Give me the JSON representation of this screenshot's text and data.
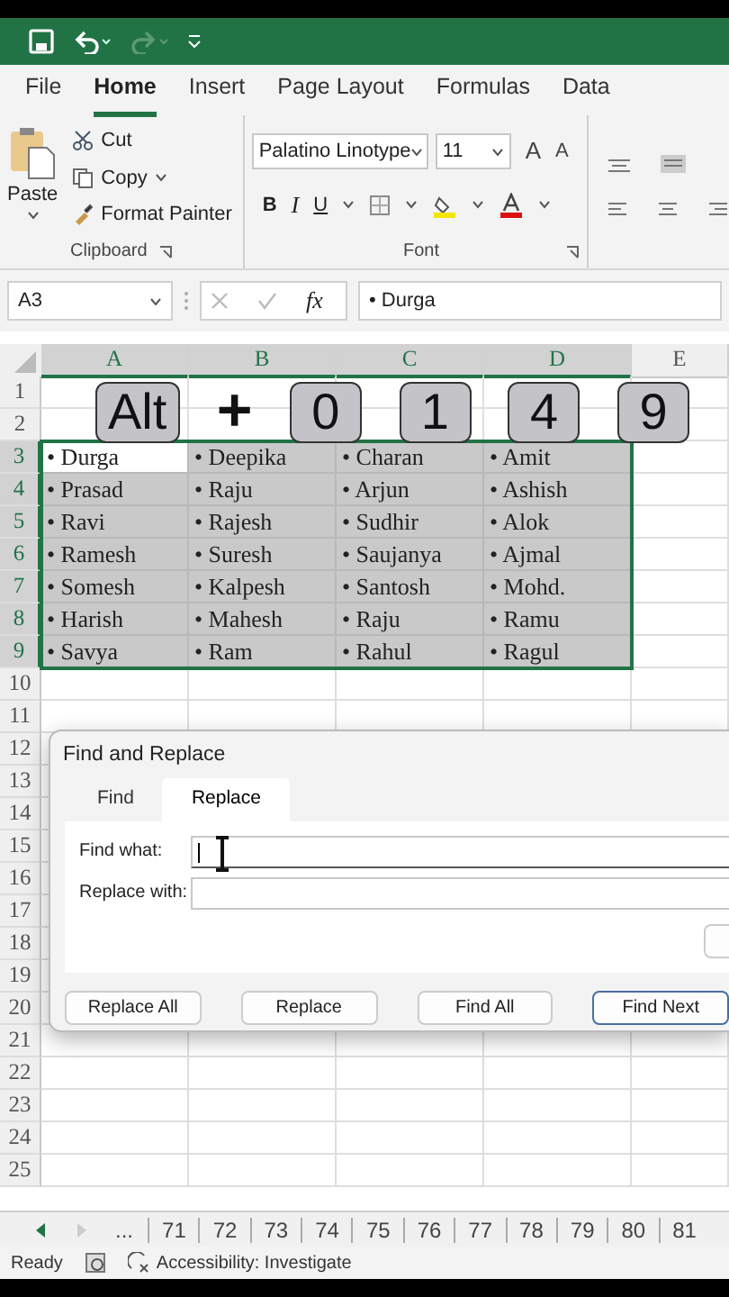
{
  "ribbon": {
    "tabs": [
      {
        "label": "File",
        "selected": false
      },
      {
        "label": "Home",
        "selected": true
      },
      {
        "label": "Insert",
        "selected": false
      },
      {
        "label": "Page Layout",
        "selected": false
      },
      {
        "label": "Formulas",
        "selected": false
      },
      {
        "label": "Data",
        "selected": false
      }
    ],
    "clipboard": {
      "paste": "Paste",
      "cut": "Cut",
      "copy": "Copy",
      "format_painter": "Format Painter",
      "label": "Clipboard"
    },
    "font": {
      "name": "Palatino Linotype",
      "size": "11",
      "grow": "A",
      "shrink": "A",
      "bold": "B",
      "italic": "I",
      "underline": "U",
      "label": "Font"
    }
  },
  "formula_bar": {
    "name_box": "A3",
    "fx": "fx",
    "formula": "• Durga"
  },
  "sheet": {
    "columns": [
      {
        "label": "A",
        "selected": true
      },
      {
        "label": "B",
        "selected": true
      },
      {
        "label": "C",
        "selected": true
      },
      {
        "label": "D",
        "selected": true
      },
      {
        "label": "E",
        "selected": false
      }
    ],
    "rows": [
      {
        "header": "1",
        "selected": false,
        "cells": []
      },
      {
        "header": "2",
        "selected": false,
        "cells": []
      },
      {
        "header": "3",
        "selected": true,
        "cells": [
          {
            "text": "• Durga",
            "selected": true,
            "active": true
          },
          {
            "text": "• Deepika",
            "selected": true,
            "active": false
          },
          {
            "text": "• Charan",
            "selected": true,
            "active": false
          },
          {
            "text": "• Amit",
            "selected": true,
            "active": false
          }
        ]
      },
      {
        "header": "4",
        "selected": true,
        "cells": [
          {
            "text": "• Prasad",
            "selected": true,
            "active": false
          },
          {
            "text": "• Raju",
            "selected": true,
            "active": false
          },
          {
            "text": "• Arjun",
            "selected": true,
            "active": false
          },
          {
            "text": "• Ashish",
            "selected": true,
            "active": false
          }
        ]
      },
      {
        "header": "5",
        "selected": true,
        "cells": [
          {
            "text": "• Ravi",
            "selected": true,
            "active": false
          },
          {
            "text": "• Rajesh",
            "selected": true,
            "active": false
          },
          {
            "text": "• Sudhir",
            "selected": true,
            "active": false
          },
          {
            "text": "• Alok",
            "selected": true,
            "active": false
          }
        ]
      },
      {
        "header": "6",
        "selected": true,
        "cells": [
          {
            "text": "• Ramesh",
            "selected": true,
            "active": false
          },
          {
            "text": "• Suresh",
            "selected": true,
            "active": false
          },
          {
            "text": "• Saujanya",
            "selected": true,
            "active": false
          },
          {
            "text": "• Ajmal",
            "selected": true,
            "active": false
          }
        ]
      },
      {
        "header": "7",
        "selected": true,
        "cells": [
          {
            "text": "• Somesh",
            "selected": true,
            "active": false
          },
          {
            "text": "• Kalpesh",
            "selected": true,
            "active": false
          },
          {
            "text": "• Santosh",
            "selected": true,
            "active": false
          },
          {
            "text": "• Mohd.",
            "selected": true,
            "active": false
          }
        ]
      },
      {
        "header": "8",
        "selected": true,
        "cells": [
          {
            "text": "• Harish",
            "selected": true,
            "active": false
          },
          {
            "text": "• Mahesh",
            "selected": true,
            "active": false
          },
          {
            "text": "• Raju",
            "selected": true,
            "active": false
          },
          {
            "text": "• Ramu",
            "selected": true,
            "active": false
          }
        ]
      },
      {
        "header": "9",
        "selected": true,
        "cells": [
          {
            "text": "• Savya",
            "selected": true,
            "active": false
          },
          {
            "text": "• Ram",
            "selected": true,
            "active": false
          },
          {
            "text": "• Rahul",
            "selected": true,
            "active": false
          },
          {
            "text": "• Ragul",
            "selected": true,
            "active": false
          }
        ]
      },
      {
        "header": "10",
        "selected": false,
        "cells": []
      },
      {
        "header": "11",
        "selected": false,
        "cells": []
      },
      {
        "header": "12",
        "selected": false,
        "cells": []
      },
      {
        "header": "13",
        "selected": false,
        "cells": []
      },
      {
        "header": "14",
        "selected": false,
        "cells": []
      },
      {
        "header": "15",
        "selected": false,
        "cells": []
      },
      {
        "header": "16",
        "selected": false,
        "cells": []
      },
      {
        "header": "17",
        "selected": false,
        "cells": []
      },
      {
        "header": "18",
        "selected": false,
        "cells": []
      },
      {
        "header": "19",
        "selected": false,
        "cells": []
      },
      {
        "header": "20",
        "selected": false,
        "cells": []
      },
      {
        "header": "21",
        "selected": false,
        "cells": []
      },
      {
        "header": "22",
        "selected": false,
        "cells": []
      },
      {
        "header": "23",
        "selected": false,
        "cells": []
      },
      {
        "header": "24",
        "selected": false,
        "cells": []
      },
      {
        "header": "25",
        "selected": false,
        "cells": []
      }
    ]
  },
  "keys": [
    {
      "label": "Alt",
      "kind": "key"
    },
    {
      "label": "+",
      "kind": "plus"
    },
    {
      "label": "0",
      "kind": "key"
    },
    {
      "label": "1",
      "kind": "key"
    },
    {
      "label": "4",
      "kind": "key"
    },
    {
      "label": "9",
      "kind": "key"
    }
  ],
  "dialog": {
    "title": "Find and Replace",
    "tabs": [
      {
        "label": "Find",
        "selected": false
      },
      {
        "label": "Replace",
        "selected": true
      }
    ],
    "fields": [
      {
        "label": "Find what:",
        "focused": true
      },
      {
        "label": "Replace with:",
        "focused": false
      }
    ],
    "buttons": [
      {
        "label": "Replace All",
        "default": false
      },
      {
        "label": "Replace",
        "default": false
      },
      {
        "label": "Find All",
        "default": false
      },
      {
        "label": "Find Next",
        "default": true
      }
    ]
  },
  "sheet_tabs": {
    "overflow": "...",
    "tabs": [
      "71",
      "72",
      "73",
      "74",
      "75",
      "76",
      "77",
      "78",
      "79",
      "80",
      "81"
    ]
  },
  "status_bar": {
    "mode": "Ready",
    "accessibility": "Accessibility: Investigate"
  }
}
